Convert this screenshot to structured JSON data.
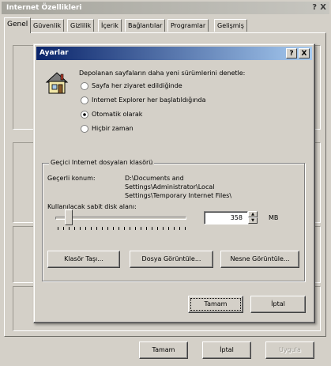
{
  "outer": {
    "title": "Internet Özellikleri",
    "help": "?",
    "close": "X",
    "tabs": [
      "Genel",
      "Güvenlik",
      "Gizlilik",
      "İçerik",
      "Bağlantılar",
      "Programlar",
      "Gelişmiş"
    ],
    "buttons": {
      "ok": "Tamam",
      "cancel": "İptal",
      "apply": "Uygula"
    }
  },
  "dialog": {
    "title": "Ayarlar",
    "help": "?",
    "close": "X",
    "check_heading": "Depolanan sayfaların daha yeni sürümlerini denetle:",
    "options": [
      {
        "label": "Sayfa her ziyaret edildiğinde",
        "selected": false
      },
      {
        "label": "Internet Explorer her başlatıldığında",
        "selected": false
      },
      {
        "label": "Otomatik olarak",
        "selected": true
      },
      {
        "label": "Hiçbir zaman",
        "selected": false
      }
    ],
    "group": {
      "title": "Geçici Internet dosyaları klasörü",
      "location_label": "Geçerli konum:",
      "location_lines": [
        "D:\\Documents and",
        "Settings\\Administrator\\Local",
        "Settings\\Temporary Internet Files\\"
      ],
      "disk_label": "Kullanılacak sabit disk alanı:",
      "disk_value": "358",
      "disk_unit": "MB"
    },
    "buttons": {
      "move_folder": "Klasör Taşı...",
      "view_files": "Dosya Görüntüle...",
      "view_objects": "Nesne Görüntüle...",
      "ok": "Tamam",
      "cancel": "İptal"
    }
  }
}
